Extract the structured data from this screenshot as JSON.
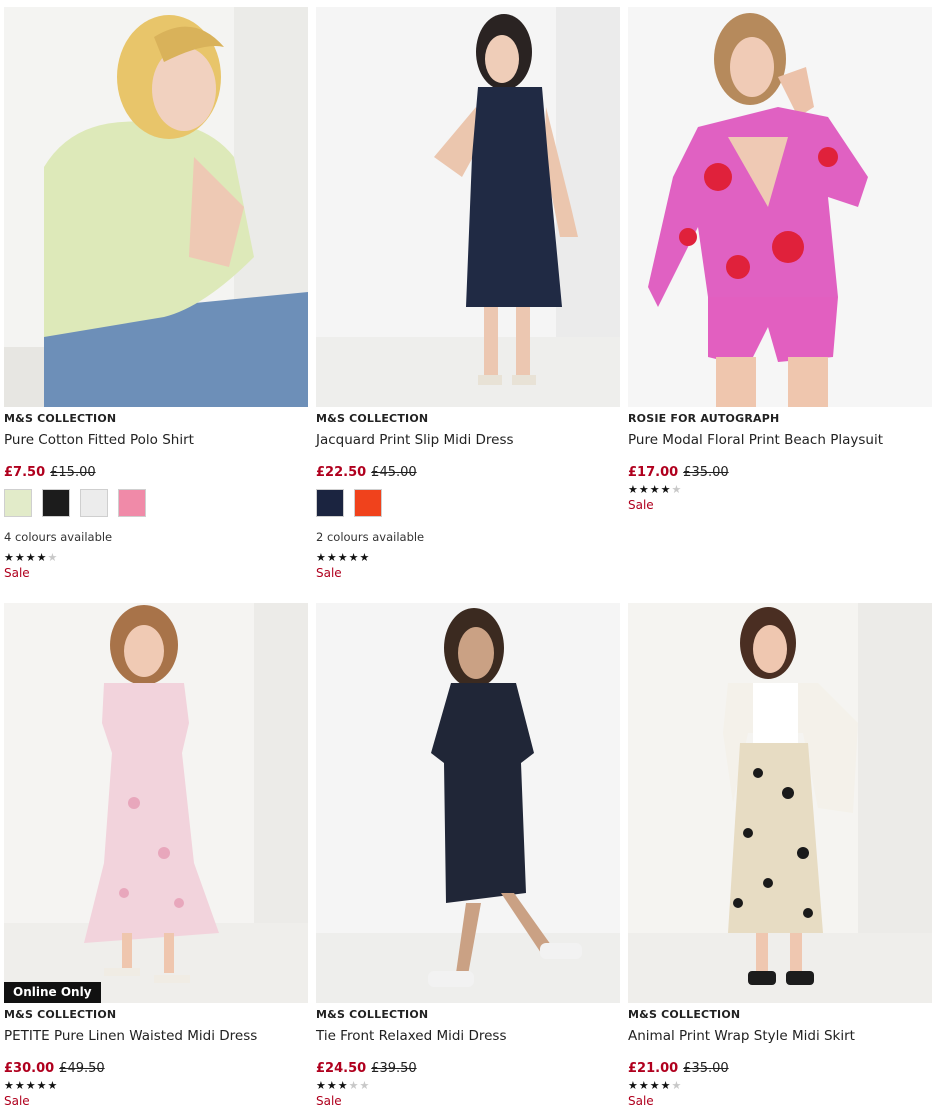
{
  "products": [
    {
      "brand": "M&S COLLECTION",
      "title": "Pure Cotton Fitted Polo Shirt",
      "price_now": "£7.50",
      "price_was": "£15.00",
      "swatches": [
        "#e2ebc9",
        "#1c1c1c",
        "#ececec",
        "#f08aa8"
      ],
      "colours_text": "4 colours available",
      "rating": 4,
      "sale": "Sale"
    },
    {
      "brand": "M&S COLLECTION",
      "title": "Jacquard Print Slip Midi Dress",
      "price_now": "£22.50",
      "price_was": "£45.00",
      "swatches": [
        "#1b2440",
        "#f0421c"
      ],
      "colours_text": "2 colours available",
      "rating": 5,
      "sale": "Sale"
    },
    {
      "brand": "ROSIE FOR AUTOGRAPH",
      "title": "Pure Modal Floral Print Beach Playsuit",
      "price_now": "£17.00",
      "price_was": "£35.00",
      "rating": 4,
      "sale": "Sale"
    },
    {
      "brand": "M&S COLLECTION",
      "title": "PETITE Pure Linen Waisted Midi Dress",
      "price_now": "£30.00",
      "price_was": "£49.50",
      "rating": 4.5,
      "sale": "Sale",
      "badge": "Online Only"
    },
    {
      "brand": "M&S COLLECTION",
      "title": "Tie Front Relaxed Midi Dress",
      "price_now": "£24.50",
      "price_was": "£39.50",
      "rating": 3,
      "sale": "Sale"
    },
    {
      "brand": "M&S COLLECTION",
      "title": "Animal Print Wrap Style Midi Skirt",
      "price_now": "£21.00",
      "price_was": "£35.00",
      "rating": 4,
      "sale": "Sale"
    }
  ],
  "colors": {
    "sale_red": "#b0001e",
    "star_on": "#111111",
    "star_off": "#c8c8c8"
  }
}
